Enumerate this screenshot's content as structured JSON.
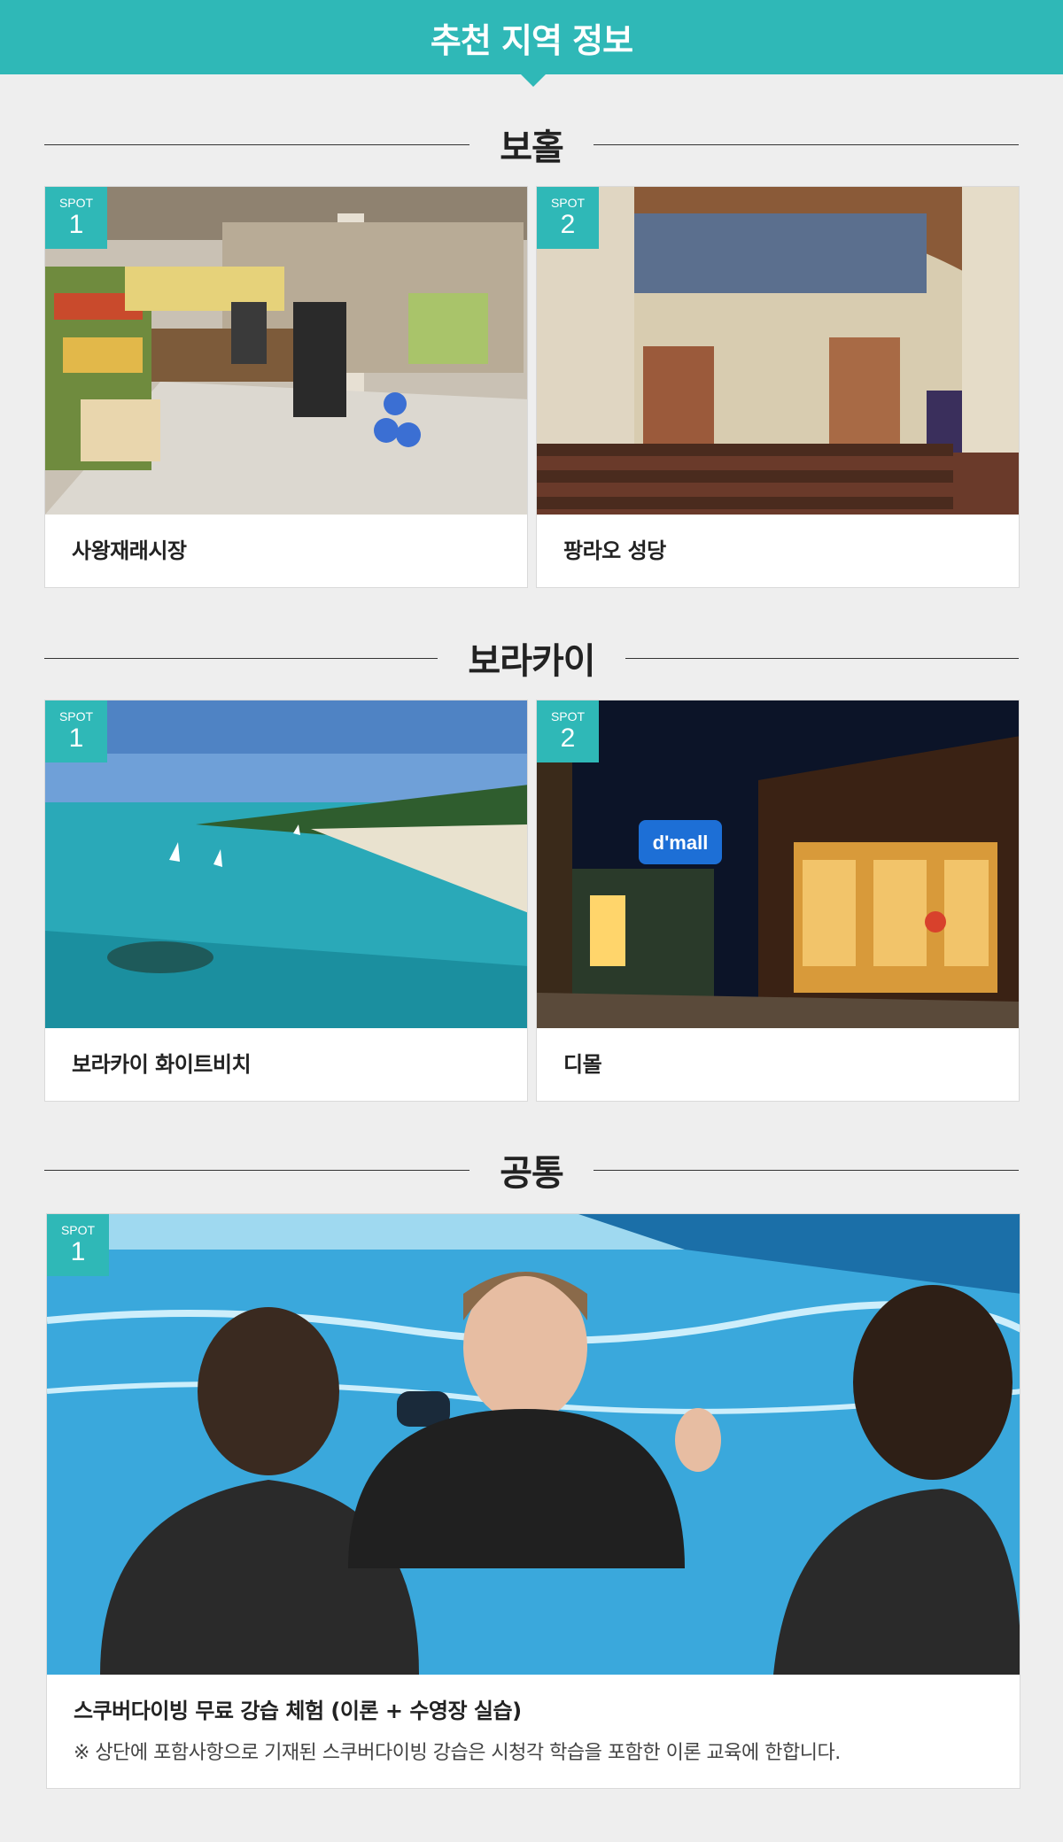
{
  "header": {
    "title": "추천 지역 정보"
  },
  "badge_word": "SPOT",
  "sections": [
    {
      "title": "보홀",
      "spots": [
        {
          "number": "1",
          "name": "사왕재래시장",
          "image": "market-photo"
        },
        {
          "number": "2",
          "name": "팡라오 성당",
          "image": "church-photo"
        }
      ]
    },
    {
      "title": "보라카이",
      "spots": [
        {
          "number": "1",
          "name": "보라카이 화이트비치",
          "image": "beach-photo"
        },
        {
          "number": "2",
          "name": "디몰",
          "image": "dmall-photo"
        }
      ]
    },
    {
      "title": "공통",
      "spots": [
        {
          "number": "1",
          "name": "스쿠버다이빙 무료 강습 체험 (이론 + 수영장 실습)",
          "note": "※ 상단에 포함사항으로 기재된 스쿠버다이빙 강습은 시청각 학습을 포함한 이론 교육에 한합니다.",
          "image": "scuba-pool-photo"
        }
      ]
    }
  ],
  "colors": {
    "accent": "#2fb8b7",
    "background": "#eeeeee"
  },
  "dmall_sign": "d'mall"
}
